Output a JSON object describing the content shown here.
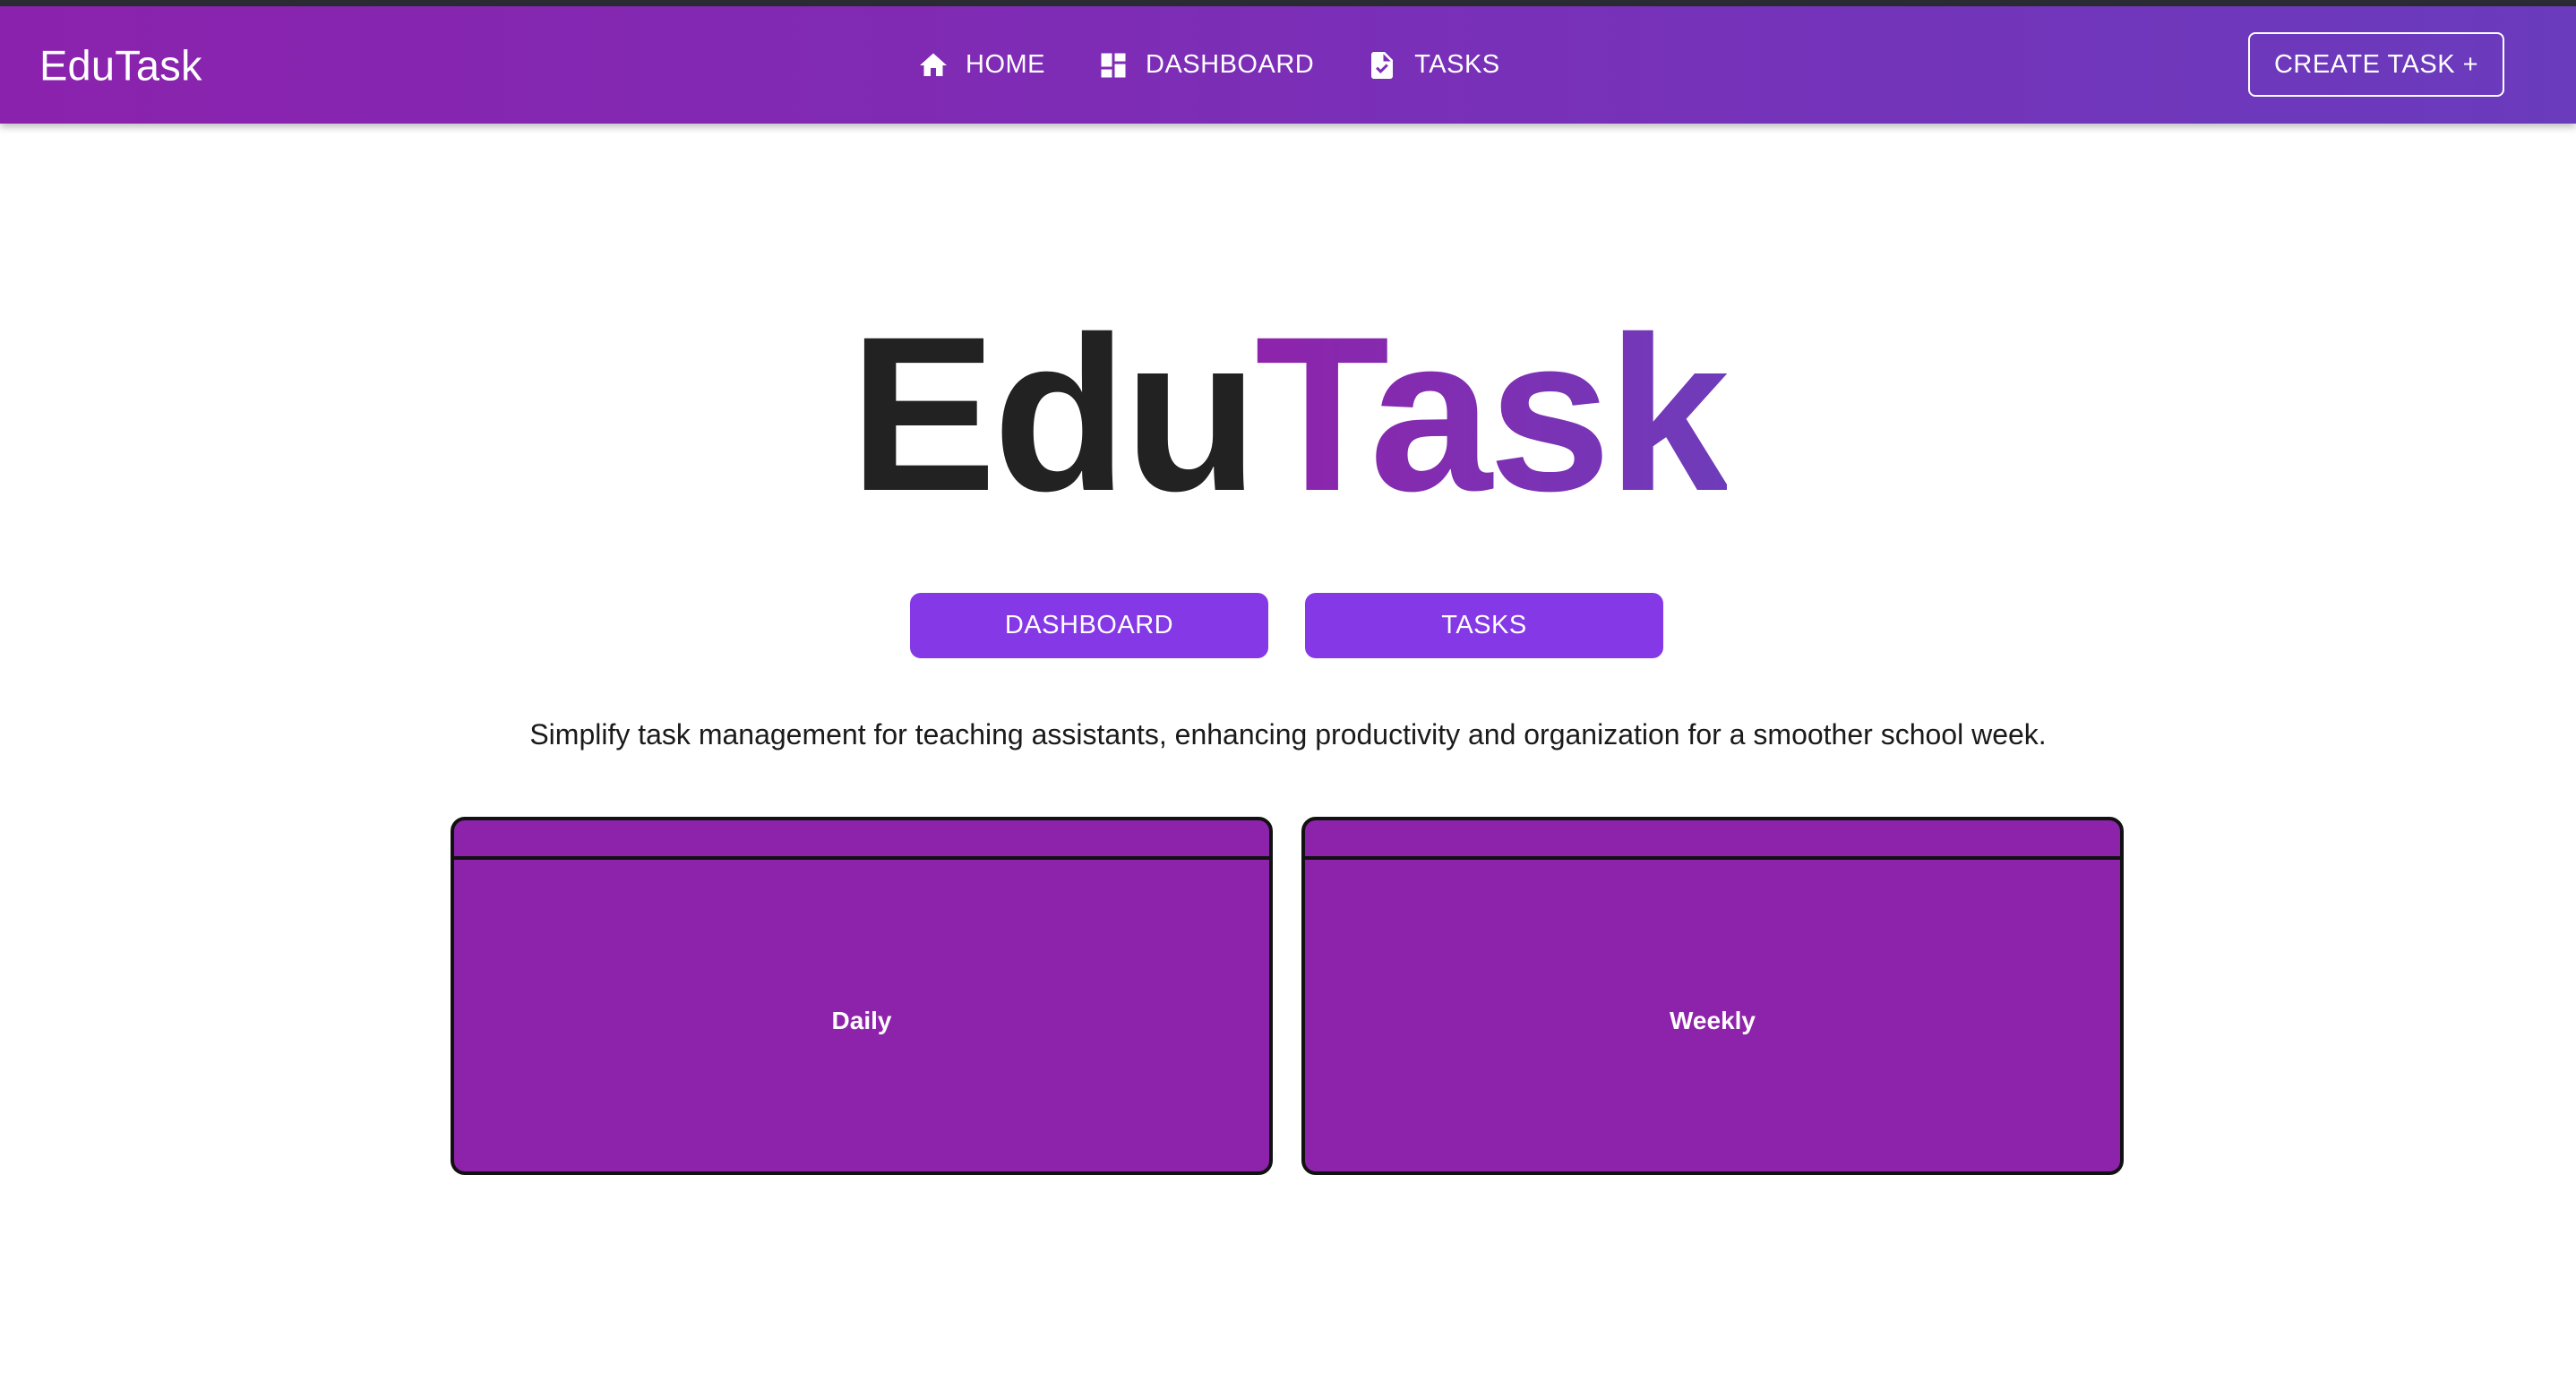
{
  "navbar": {
    "brand": "EduTask",
    "links": [
      {
        "label": "HOME",
        "icon": "home-icon"
      },
      {
        "label": "DASHBOARD",
        "icon": "dashboard-icon"
      },
      {
        "label": "TASKS",
        "icon": "task-icon"
      }
    ],
    "create_label": "CREATE TASK +"
  },
  "hero": {
    "title_part1": "Edu",
    "title_part2": "Task",
    "buttons": [
      {
        "label": "DASHBOARD"
      },
      {
        "label": "TASKS"
      }
    ],
    "tagline": "Simplify task management for teaching assistants, enhancing productivity and organization for a smoother school week."
  },
  "cards": [
    {
      "label": "Daily"
    },
    {
      "label": "Weekly"
    }
  ],
  "colors": {
    "nav_gradient_start": "#8b22ad",
    "nav_gradient_end": "#6a3bbd",
    "button_purple": "#8438e6",
    "card_purple": "#8e23ab",
    "text_dark": "#222222"
  }
}
